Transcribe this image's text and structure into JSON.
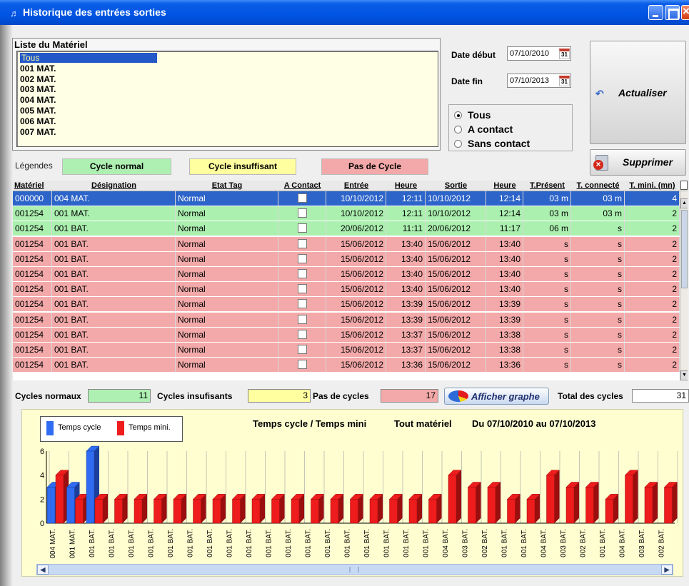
{
  "window": {
    "title": "Historique des entrées sorties"
  },
  "materials": {
    "title": "Liste du Matériel",
    "items": [
      "Tous",
      "001 MAT.",
      "002 MAT.",
      "003 MAT.",
      "004 MAT.",
      "005 MAT.",
      "006 MAT.",
      "007 MAT."
    ],
    "selected": "Tous"
  },
  "dates": {
    "start_label": "Date début",
    "start_value": "07/10/2010",
    "end_label": "Date fin",
    "end_value": "07/10/2013",
    "calendar_icon_text": "31"
  },
  "filter": {
    "options": [
      "Tous",
      "A contact",
      "Sans contact"
    ],
    "selected": "Tous"
  },
  "buttons": {
    "refresh": "Actualiser",
    "delete": "Supprimer",
    "graph": "Afficher graphe"
  },
  "legend": {
    "label": "Légendes",
    "items": [
      {
        "label": "Cycle normal",
        "color": "#aef0b2"
      },
      {
        "label": "Cycle insuffisant",
        "color": "#ffffa0"
      },
      {
        "label": "Pas de Cycle",
        "color": "#f3a9a9"
      }
    ]
  },
  "table": {
    "columns": [
      "Matériel",
      "Désignation",
      "Etat Tag",
      "A Contact",
      "Entrée",
      "Heure",
      "Sortie",
      "Heure",
      "T.Présent",
      "T. connecté",
      "T. mini. (mn)"
    ],
    "rows": [
      {
        "style": "sel",
        "cells": [
          "000000",
          "004 MAT.",
          "Normal",
          "",
          "10/10/2012",
          "12:11",
          "10/10/2012",
          "12:14",
          "03 m",
          "03 m",
          "4"
        ]
      },
      {
        "style": "green",
        "cells": [
          "001254",
          "001 MAT.",
          "Normal",
          "",
          "10/10/2012",
          "12:11",
          "10/10/2012",
          "12:14",
          "03 m",
          "03 m",
          "2"
        ]
      },
      {
        "style": "green",
        "cells": [
          "001254",
          "001 BAT.",
          "Normal",
          "",
          "20/06/2012",
          "11:11",
          "20/06/2012",
          "11:17",
          "06 m",
          "s",
          "2"
        ]
      },
      {
        "style": "red",
        "cells": [
          "001254",
          "001 BAT.",
          "Normal",
          "",
          "15/06/2012",
          "13:40",
          "15/06/2012",
          "13:40",
          "s",
          "s",
          "2"
        ]
      },
      {
        "style": "red",
        "cells": [
          "001254",
          "001 BAT.",
          "Normal",
          "",
          "15/06/2012",
          "13:40",
          "15/06/2012",
          "13:40",
          "s",
          "s",
          "2"
        ]
      },
      {
        "style": "red",
        "cells": [
          "001254",
          "001 BAT.",
          "Normal",
          "",
          "15/06/2012",
          "13:40",
          "15/06/2012",
          "13:40",
          "s",
          "s",
          "2"
        ]
      },
      {
        "style": "red",
        "cells": [
          "001254",
          "001 BAT.",
          "Normal",
          "",
          "15/06/2012",
          "13:40",
          "15/06/2012",
          "13:40",
          "s",
          "s",
          "2"
        ]
      },
      {
        "style": "red",
        "cells": [
          "001254",
          "001 BAT.",
          "Normal",
          "",
          "15/06/2012",
          "13:39",
          "15/06/2012",
          "13:39",
          "s",
          "s",
          "2"
        ]
      },
      {
        "style": "red",
        "cells": [
          "001254",
          "001 BAT.",
          "Normal",
          "",
          "15/06/2012",
          "13:39",
          "15/06/2012",
          "13:39",
          "s",
          "s",
          "2"
        ]
      },
      {
        "style": "red",
        "cells": [
          "001254",
          "001 BAT.",
          "Normal",
          "",
          "15/06/2012",
          "13:37",
          "15/06/2012",
          "13:38",
          "s",
          "s",
          "2"
        ]
      },
      {
        "style": "red",
        "cells": [
          "001254",
          "001 BAT.",
          "Normal",
          "",
          "15/06/2012",
          "13:37",
          "15/06/2012",
          "13:38",
          "s",
          "s",
          "2"
        ]
      },
      {
        "style": "red",
        "cells": [
          "001254",
          "001 BAT.",
          "Normal",
          "",
          "15/06/2012",
          "13:36",
          "15/06/2012",
          "13:36",
          "s",
          "s",
          "2"
        ]
      }
    ]
  },
  "stats": {
    "normal_label": "Cycles normaux",
    "normal_value": "11",
    "insufficient_label": "Cycles insufisants",
    "insufficient_value": "3",
    "none_label": "Pas de cycles",
    "none_value": "17",
    "total_label": "Total des cycles",
    "total_value": "31"
  },
  "chart_data": {
    "type": "bar",
    "title_parts": [
      "Temps cycle / Temps mini",
      "Tout matériel",
      "Du 07/10/2010 au 07/10/2013"
    ],
    "legend": [
      "Temps cycle",
      "Temps mini."
    ],
    "colors": {
      "cycle": "#2f6cf2",
      "mini": "#ee1c1c"
    },
    "yticks": [
      "0",
      "2",
      "4",
      "6"
    ],
    "ylim": [
      0,
      6
    ],
    "categories": [
      "004 MAT.",
      "001 MAT.",
      "001 BAT.",
      "001 BAT.",
      "001 BAT.",
      "001 BAT.",
      "001 BAT.",
      "001 BAT.",
      "001 BAT.",
      "001 BAT.",
      "001 BAT.",
      "001 BAT.",
      "001 BAT.",
      "001 BAT.",
      "001 BAT.",
      "001 BAT.",
      "001 BAT.",
      "001 BAT.",
      "001 BAT.",
      "001 BAT.",
      "004 BAT.",
      "003 BAT.",
      "002 BAT.",
      "001 BAT.",
      "001 BAT.",
      "004 BAT.",
      "003 BAT.",
      "002 BAT.",
      "001 BAT.",
      "004 BAT.",
      "003 BAT.",
      "002 BAT."
    ],
    "series": [
      {
        "name": "Temps cycle",
        "values": [
          3,
          3,
          6,
          0,
          0,
          0,
          0,
          0,
          0,
          0,
          0,
          0,
          0,
          0,
          0,
          0,
          0,
          0,
          0,
          0,
          0,
          0,
          0,
          0,
          0,
          0,
          0,
          0,
          0,
          0,
          0,
          0
        ]
      },
      {
        "name": "Temps mini.",
        "values": [
          4,
          2,
          2,
          2,
          2,
          2,
          2,
          2,
          2,
          2,
          2,
          2,
          2,
          2,
          2,
          2,
          2,
          2,
          2,
          2,
          4,
          3,
          3,
          2,
          2,
          4,
          3,
          3,
          2,
          4,
          3,
          3
        ]
      }
    ]
  }
}
